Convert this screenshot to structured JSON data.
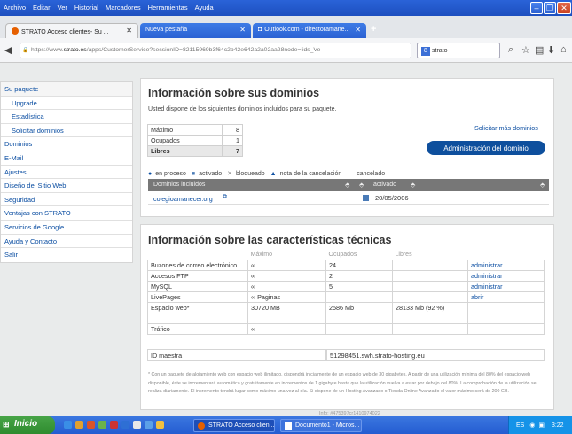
{
  "menubar": {
    "items": [
      "Archivo",
      "Editar",
      "Ver",
      "Historial",
      "Marcadores",
      "Herramientas",
      "Ayuda"
    ]
  },
  "tabs": [
    {
      "label": "STRATO Acceso clientes- Su ..."
    },
    {
      "label": "Nueva pestaña"
    },
    {
      "label": "Outlook.com - directoramane..."
    }
  ],
  "nav": {
    "url_prefix": "https://www.",
    "url_host": "strato.es",
    "url_path": "/apps/CustomerService?sessionID=82115969b3f64c2b42e642a2a02aa28node=lids_Ve",
    "search_value": "strato"
  },
  "sidebar": {
    "items": [
      {
        "label": "Su paquete",
        "level": "head"
      },
      {
        "label": "Upgrade",
        "level": "sub"
      },
      {
        "label": "Estadística",
        "level": "sub"
      },
      {
        "label": "Solicitar dominios",
        "level": "sub"
      },
      {
        "label": "Dominios",
        "level": "top"
      },
      {
        "label": "E-Mail",
        "level": "top"
      },
      {
        "label": "Ajustes",
        "level": "top"
      },
      {
        "label": "Diseño del Sitio Web",
        "level": "top"
      },
      {
        "label": "Seguridad",
        "level": "top"
      },
      {
        "label": "Ventajas con STRATO",
        "level": "top"
      },
      {
        "label": "Servicios de Google",
        "level": "top"
      },
      {
        "label": "Ayuda y Contacto",
        "level": "top"
      },
      {
        "label": "Salir",
        "level": "top"
      }
    ]
  },
  "domains": {
    "title": "Información sobre sus dominios",
    "subtitle": "Usted dispone de los siguientes dominios incluidos para su paquete.",
    "request_more": "Solicitar más dominios",
    "admin_button": "Administración del dominio",
    "counts": [
      {
        "label": "Máximo",
        "value": "8"
      },
      {
        "label": "Ocupados",
        "value": "1"
      },
      {
        "label": "Libres",
        "value": "7"
      }
    ],
    "legend": [
      "en proceso",
      "activado",
      "bloqueado",
      "nota de la cancelación",
      "cancelado"
    ],
    "table_header_name": "Dominios incluidos",
    "table_header_status": "activado",
    "rows": [
      {
        "domain": "colegioamanecer.org",
        "date": "20/05/2006"
      }
    ]
  },
  "tech": {
    "title": "Información sobre las características técnicas",
    "headers": [
      "Máximo",
      "Ocupados",
      "Libres"
    ],
    "rows": [
      {
        "name": "Buzones de correo electrónico",
        "max": "∞",
        "used": "24",
        "free": "",
        "action": "administrar"
      },
      {
        "name": "Accesos FTP",
        "max": "∞",
        "used": "2",
        "free": "",
        "action": "administrar"
      },
      {
        "name": "MySQL",
        "max": "∞",
        "used": "5",
        "free": "",
        "action": "administrar"
      },
      {
        "name": "LivePages",
        "max": "∞ Paginas",
        "used": "",
        "free": "",
        "action": "abrir"
      },
      {
        "name": "Espacio web*",
        "max": "30720 MB",
        "used": "2586 Mb",
        "free": "28133 Mb (92 %)",
        "action": ""
      },
      {
        "name": "Tráfico",
        "max": "∞",
        "used": "",
        "free": "",
        "action": ""
      }
    ],
    "id_label": "ID maestra",
    "id_value": "51298451.swh.strato-hosting.eu",
    "footnote": "* Con un paquete de alojamiento web con espacio web ilimitado, dispondrá inicialmente de un espacio web de 30 gigabytes. A partir de una utilización mínima del 80% del espacio web disponible, éste se incrementará automática y gratuitamente en incrementos de 1 gigabyte hasta que la utilización vuelva a estar por debajo del 80%. La comprobación de la utilización se realiza diariamente. El incremento tendrá lugar como máximo una vez al día. Si dispone de un Hosting Avanzado o Tienda Online Avanzado el valor máximo será de 200 GB.",
    "info_id": "Info: #475397cr1410974022"
  },
  "taskbar": {
    "start": "Inicio",
    "tasks": [
      "STRATO Acceso clien...",
      "Documento1 - Micros..."
    ],
    "lang": "ES",
    "clock": "3:22"
  },
  "colors": {
    "link": "#0b4ea2",
    "button": "#0e4f9d",
    "xp_blue": "#245cd1"
  }
}
